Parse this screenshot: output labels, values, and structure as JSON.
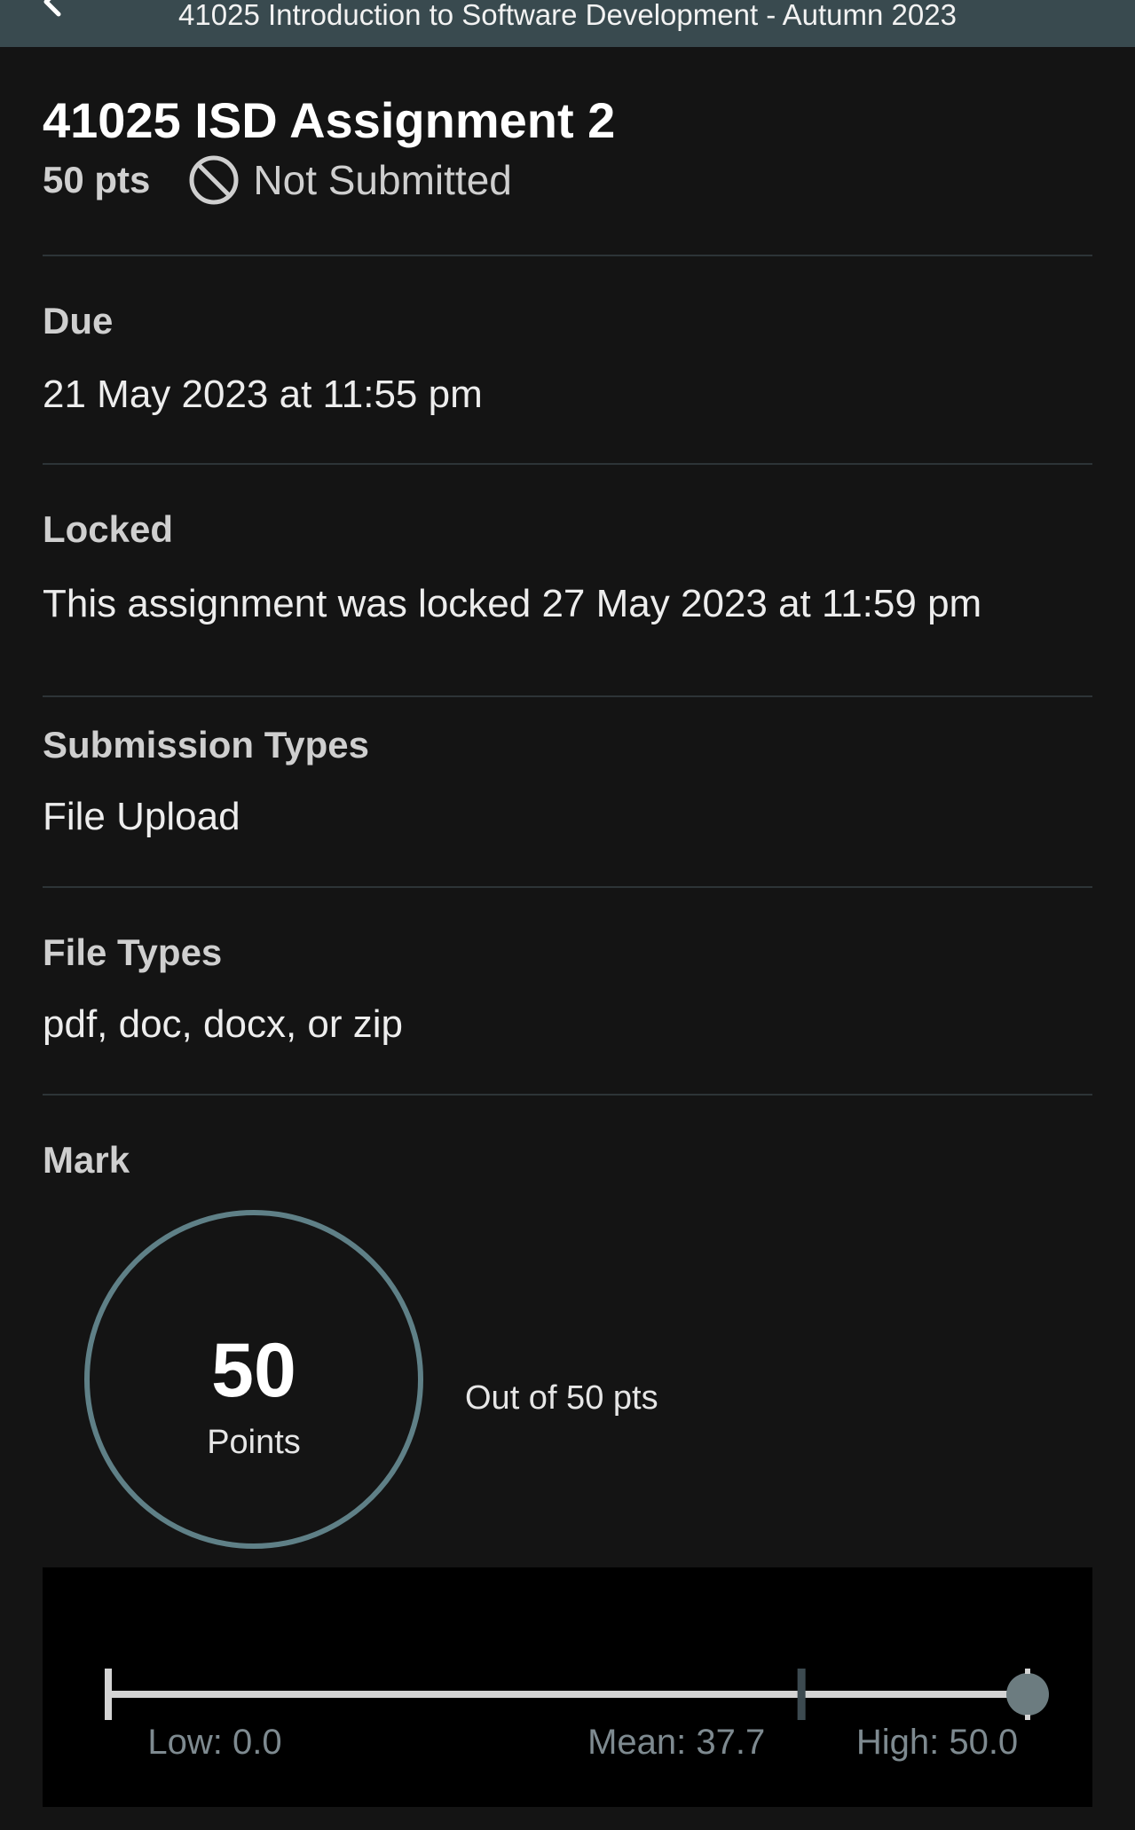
{
  "header": {
    "title": "41025 Introduction to Software Development - Autumn 2023",
    "back_icon": "chevron-left-icon",
    "background": "#394a4f"
  },
  "assignment": {
    "title": "41025 ISD Assignment 2",
    "points": "50 pts",
    "status_icon": "not-allowed-icon",
    "status": "Not Submitted"
  },
  "sections": {
    "due": {
      "label": "Due",
      "value": "21 May 2023 at 11:55 pm"
    },
    "locked": {
      "label": "Locked",
      "value": "This assignment was locked 27 May 2023 at 11:59 pm"
    },
    "submission_types": {
      "label": "Submission Types",
      "value": "File Upload"
    },
    "file_types": {
      "label": "File Types",
      "value": "pdf, doc, docx, or zip"
    },
    "mark": {
      "label": "Mark"
    }
  },
  "mark": {
    "score": "50",
    "score_label": "Points",
    "out_of": "Out of 50 pts",
    "ring_color": "#5f8087",
    "fraction": 1.0
  },
  "stats": {
    "low": 0.0,
    "mean": 37.7,
    "high": 50.0,
    "score": 50.0,
    "low_label": "Low: 0.0",
    "mean_label": "Mean: 37.7",
    "high_label": "High: 50.0"
  },
  "colors": {
    "background": "#141414",
    "divider": "#2d3437",
    "stat_text": "#7e8a90"
  }
}
